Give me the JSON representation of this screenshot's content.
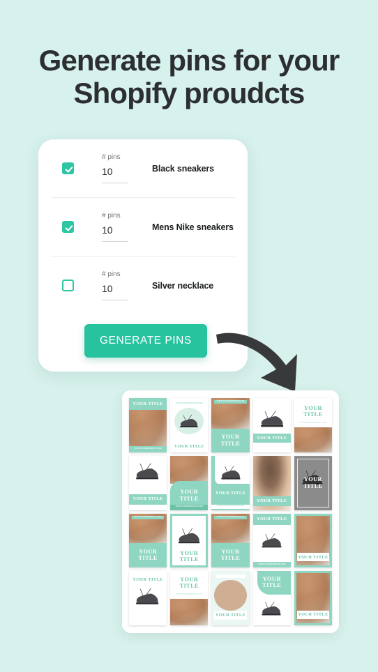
{
  "heading": {
    "line1": "Generate pins for your",
    "line2": "Shopify proudcts"
  },
  "colors": {
    "background": "#d7f1ec",
    "accent_green": "#27c39f",
    "checkbox_green": "#2ec5a3",
    "pin_mint": "#8fd6c2",
    "heading_text": "#2c2f31",
    "arrow": "#38393b",
    "gray_pin": "#8b8b8b"
  },
  "form_card": {
    "rows": [
      {
        "checked": true,
        "pins_label": "# pins",
        "pins_value": "10",
        "product_name": "Black sneakers"
      },
      {
        "checked": true,
        "pins_label": "# pins",
        "pins_value": "10",
        "product_name": "Mens Nike sneakers"
      },
      {
        "checked": false,
        "pins_label": "# pins",
        "pins_value": "10",
        "product_name": "Silver necklace"
      }
    ],
    "generate_button": "GENERATE PINS"
  },
  "arrow": {
    "icon": "curved-arrow-down-right-icon"
  },
  "pin_grid": {
    "columns": 5,
    "rows": 4,
    "default_title": "YOUR TITLE",
    "pins": [
      {
        "id": 1,
        "layout": "title-band-top",
        "title": "YOUR TITLE",
        "subtitle": "WWW.YOURWEBSITE.COM",
        "image": "necklace-photo"
      },
      {
        "id": 2,
        "layout": "circle-image-title-bottom",
        "title": "YOUR TITLE",
        "subtitle": "WWW.YOURWEBSITE.COM",
        "image": "sneaker-photo"
      },
      {
        "id": 3,
        "layout": "photo-top-title-bottom",
        "title": "YOUR TITLE",
        "subtitle": "WWW.YOURWEBSITE.COM",
        "image": "necklace-photo"
      },
      {
        "id": 4,
        "layout": "shoe-title-band-bottom",
        "title": "YOUR TITLE",
        "subtitle": "",
        "image": "sneaker-photo"
      },
      {
        "id": 5,
        "layout": "title-top-photo-bottom",
        "title": "YOUR TITLE",
        "subtitle": "WWW.YOURWEBSITE.COM",
        "image": "necklace-photo"
      },
      {
        "id": 6,
        "layout": "shoe-title-band-bottom",
        "title": "YOUR TITLE",
        "subtitle": "",
        "image": "sneaker-photo"
      },
      {
        "id": 7,
        "layout": "photo-curve-title-bottom",
        "title": "YOUR TITLE",
        "subtitle": "WWW.YOURWEBSITE.COM",
        "image": "necklace-photo"
      },
      {
        "id": 8,
        "layout": "shoe-blob-title",
        "title": "YOUR TITLE",
        "subtitle": "WWW.YOURWEBSITE.COM",
        "image": "sneaker-photo"
      },
      {
        "id": 9,
        "layout": "photo-title-band-bottom",
        "title": "YOUR TITLE",
        "subtitle": "",
        "image": "hair-photo"
      },
      {
        "id": 10,
        "layout": "gray-frame-shoe",
        "title": "YOUR TITLE",
        "subtitle": "",
        "image": "sneaker-photo"
      },
      {
        "id": 11,
        "layout": "photo-top-bigtitle-bottom",
        "title": "YOUR TITLE",
        "subtitle": "WWW.YOURWEBSITE.COM",
        "image": "necklace-photo"
      },
      {
        "id": 12,
        "layout": "shoe-center-title-bottom",
        "title": "YOUR TITLE",
        "subtitle": "",
        "image": "sneaker-photo"
      },
      {
        "id": 13,
        "layout": "photo-top-bigtitle-bottom",
        "title": "YOUR TITLE",
        "subtitle": "WWW.YOURWEBSITE.COM",
        "image": "necklace-photo"
      },
      {
        "id": 14,
        "layout": "title-band-top-shoe",
        "title": "YOUR TITLE",
        "subtitle": "WWW.YOURWEBSITE.COM",
        "image": "sneaker-photo"
      },
      {
        "id": 15,
        "layout": "photo-title-outline-bottom",
        "title": "YOUR TITLE",
        "subtitle": "",
        "image": "necklace-photo"
      },
      {
        "id": 16,
        "layout": "mint-title-top-shoe",
        "title": "YOUR TITLE",
        "subtitle": "",
        "image": "sneaker-photo"
      },
      {
        "id": 17,
        "layout": "bigtitle-top-photo-bottom",
        "title": "YOUR TITLE",
        "subtitle": "WWW.YOURWEBSITE.COM",
        "image": "necklace-photo"
      },
      {
        "id": 18,
        "layout": "circle-photo-title-bottom",
        "title": "YOUR TITLE",
        "subtitle": "",
        "image": "necklace-photo"
      },
      {
        "id": 19,
        "layout": "blob-title-top-shoe",
        "title": "YOUR TITLE",
        "subtitle": "",
        "image": "sneaker-photo"
      },
      {
        "id": 20,
        "layout": "photo-title-outline-bottom",
        "title": "YOUR TITLE",
        "subtitle": "",
        "image": "necklace-photo"
      }
    ]
  }
}
